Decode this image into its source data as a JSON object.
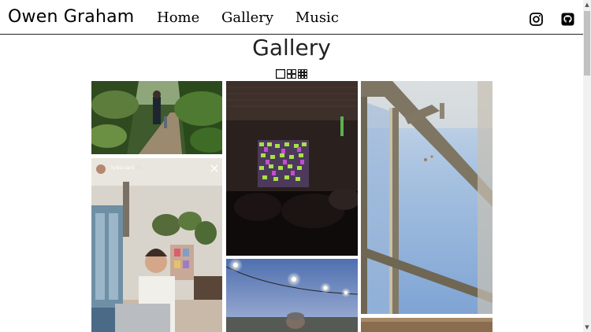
{
  "header": {
    "site_title": "Owen Graham",
    "nav": [
      {
        "label": "Home"
      },
      {
        "label": "Gallery"
      },
      {
        "label": "Music"
      }
    ],
    "social_icons": [
      "instagram-icon",
      "github-icon"
    ]
  },
  "main": {
    "title": "Gallery",
    "view_toggles": [
      "single-column-grid-icon",
      "two-column-grid-icon",
      "three-column-grid-icon"
    ]
  },
  "photos": [
    {
      "subject": "jungle-walkway"
    },
    {
      "subject": "cafe-story",
      "story_user": "lydia.cant",
      "story_time": "4h"
    },
    {
      "subject": "dark-venue-projection"
    },
    {
      "subject": "festival-lights"
    },
    {
      "subject": "window-frame-sky"
    },
    {
      "subject": "partial-photo"
    }
  ]
}
